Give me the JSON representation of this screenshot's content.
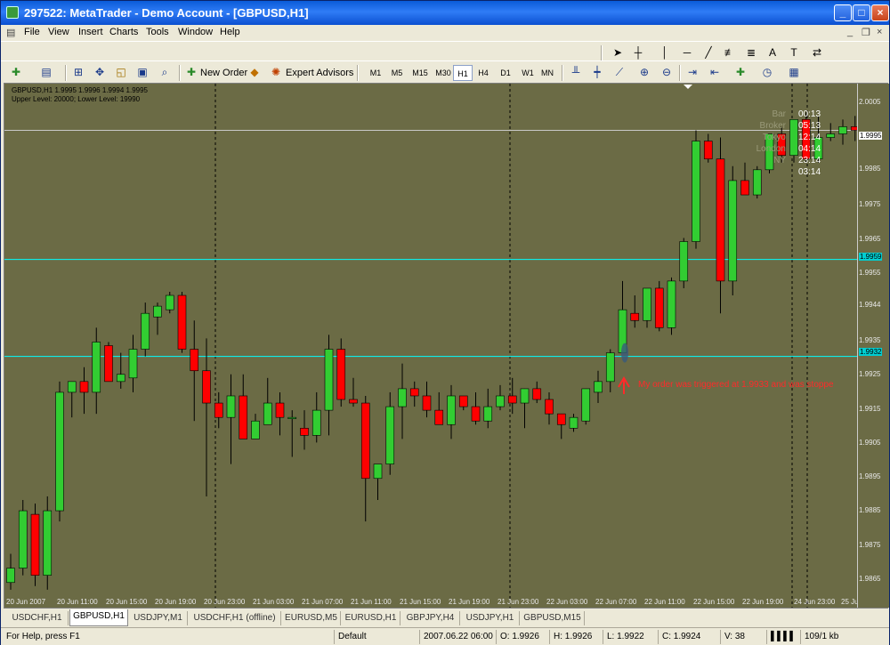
{
  "window": {
    "title": "297522: MetaTrader - Demo Account - [GBPUSD,H1]"
  },
  "menu": [
    "File",
    "View",
    "Insert",
    "Charts",
    "Tools",
    "Window",
    "Help"
  ],
  "toolbar": {
    "new_order_label": "New Order",
    "expert_advisors_label": "Expert Advisors",
    "timeframes": [
      "M1",
      "M5",
      "M15",
      "M30",
      "H1",
      "H4",
      "D1",
      "W1",
      "MN"
    ],
    "active_timeframe": "H1"
  },
  "chart": {
    "info_line1": "GBPUSD,H1  1.9995 1.9996 1.9994 1.9995",
    "info_line2": "Upper Level: 20000;  Lower Level: 19990",
    "annotation": "My order was triggered at 1.9933 and was stoppe",
    "current_price_tag": "1.9995",
    "upper_line_tag": "1.9959",
    "lower_line_tag": "1.9932",
    "y_labels": [
      "2.0005",
      "1.9995",
      "1.9985",
      "1.9975",
      "1.9965",
      "1.9955",
      "1.9944",
      "1.9935",
      "1.9925",
      "1.9915",
      "1.9905",
      "1.9895",
      "1.9885",
      "1.9875",
      "1.9865"
    ],
    "x_labels": [
      "20 Jun 2007",
      "20 Jun 11:00",
      "20 Jun 15:00",
      "20 Jun 19:00",
      "20 Jun 23:00",
      "21 Jun 03:00",
      "21 Jun 07:00",
      "21 Jun 11:00",
      "21 Jun 15:00",
      "21 Jun 19:00",
      "21 Jun 23:00",
      "22 Jun 03:00",
      "22 Jun 07:00",
      "22 Jun 11:00",
      "22 Jun 15:00",
      "22 Jun 19:00",
      "24 Jun 23:00",
      "25 Jun 03:00"
    ],
    "stats": [
      {
        "key": "Bar",
        "value": "00:13"
      },
      {
        "key": "Broker",
        "value": "05:13"
      },
      {
        "key": "Tokyo",
        "value": "12:14"
      },
      {
        "key": "London",
        "value": "04:14"
      },
      {
        "key": "NY",
        "value": "23:14"
      },
      {
        "key": "",
        "value": "03:14"
      }
    ],
    "colors": {
      "background": "#6b6b45",
      "bull": "#32cd32",
      "bear": "#ff0000",
      "level": "#00ffff",
      "annotation": "#ff2a2a"
    }
  },
  "chart_data": {
    "type": "candlestick",
    "candles": [
      [
        1.9869,
        1.9877,
        1.9867,
        1.9873
      ],
      [
        1.9873,
        1.9892,
        1.9871,
        1.9889
      ],
      [
        1.9888,
        1.9891,
        1.9868,
        1.9871
      ],
      [
        1.9871,
        1.9893,
        1.9867,
        1.9889
      ],
      [
        1.9889,
        1.9925,
        1.9886,
        1.9922
      ],
      [
        1.9922,
        1.9925,
        1.9915,
        1.9925
      ],
      [
        1.9925,
        1.9929,
        1.9916,
        1.9922
      ],
      [
        1.9922,
        1.994,
        1.9916,
        1.9936
      ],
      [
        1.9935,
        1.9936,
        1.9925,
        1.9925
      ],
      [
        1.9925,
        1.9933,
        1.9923,
        1.9927
      ],
      [
        1.9926,
        1.9938,
        1.9922,
        1.9934
      ],
      [
        1.9934,
        1.9947,
        1.9932,
        1.9944
      ],
      [
        1.9943,
        1.9947,
        1.9938,
        1.9946
      ],
      [
        1.9945,
        1.995,
        1.9944,
        1.9949
      ],
      [
        1.9949,
        1.995,
        1.9933,
        1.9934
      ],
      [
        1.9934,
        1.9942,
        1.9914,
        1.9928
      ],
      [
        1.9928,
        1.9937,
        1.9893,
        1.9919
      ],
      [
        1.9919,
        1.9922,
        1.9912,
        1.9915
      ],
      [
        1.9915,
        1.9927,
        1.9902,
        1.9921
      ],
      [
        1.9921,
        1.9927,
        1.9912,
        1.9909
      ],
      [
        1.9909,
        1.9916,
        1.9909,
        1.9914
      ],
      [
        1.9913,
        1.9926,
        1.9913,
        1.9919
      ],
      [
        1.9919,
        1.9922,
        1.991,
        1.9915
      ],
      [
        1.9915,
        1.9917,
        1.9904,
        1.9915
      ],
      [
        1.9912,
        1.9917,
        1.9906,
        1.991
      ],
      [
        1.991,
        1.9922,
        1.9908,
        1.9917
      ],
      [
        1.9917,
        1.9938,
        1.991,
        1.9934
      ],
      [
        1.9934,
        1.9937,
        1.9918,
        1.992
      ],
      [
        1.992,
        1.9926,
        1.9918,
        1.9919
      ],
      [
        1.9919,
        1.9921,
        1.9886,
        1.9898
      ],
      [
        1.9898,
        1.9899,
        1.9892,
        1.9902
      ],
      [
        1.9902,
        1.9922,
        1.9899,
        1.9918
      ],
      [
        1.9918,
        1.993,
        1.9909,
        1.9923
      ],
      [
        1.9923,
        1.9925,
        1.9918,
        1.9921
      ],
      [
        1.9921,
        1.9925,
        1.9915,
        1.9917
      ],
      [
        1.9917,
        1.9922,
        1.9913,
        1.9913
      ],
      [
        1.9913,
        1.9924,
        1.9909,
        1.9921
      ],
      [
        1.9921,
        1.9921,
        1.9917,
        1.9918
      ],
      [
        1.9918,
        1.9922,
        1.9913,
        1.9914
      ],
      [
        1.9914,
        1.9923,
        1.9912,
        1.9918
      ],
      [
        1.9918,
        1.9924,
        1.9917,
        1.9921
      ],
      [
        1.9921,
        1.9926,
        1.9916,
        1.9919
      ],
      [
        1.9919,
        1.9923,
        1.9912,
        1.9923
      ],
      [
        1.9923,
        1.9925,
        1.9919,
        1.992
      ],
      [
        1.992,
        1.9922,
        1.9913,
        1.9916
      ],
      [
        1.9916,
        1.9916,
        1.9909,
        1.9913
      ],
      [
        1.9912,
        1.9916,
        1.9911,
        1.9915
      ],
      [
        1.9914,
        1.9923,
        1.9913,
        1.9923
      ],
      [
        1.9922,
        1.9928,
        1.9919,
        1.9925
      ],
      [
        1.9925,
        1.9934,
        1.9922,
        1.9933
      ],
      [
        1.9933,
        1.9953,
        1.9933,
        1.9945
      ],
      [
        1.9944,
        1.9949,
        1.994,
        1.9942
      ],
      [
        1.9942,
        1.9951,
        1.994,
        1.9951
      ],
      [
        1.9951,
        1.9953,
        1.9939,
        1.994
      ],
      [
        1.994,
        1.9954,
        1.9938,
        1.9953
      ],
      [
        1.9953,
        1.9965,
        1.9951,
        1.9964
      ],
      [
        1.9964,
        1.9995,
        1.9962,
        1.9992
      ],
      [
        1.9992,
        1.9994,
        1.9986,
        1.9987
      ],
      [
        1.9987,
        1.9993,
        1.9944,
        1.9953
      ],
      [
        1.9953,
        1.9985,
        1.9949,
        1.9981
      ],
      [
        1.9981,
        1.9986,
        1.9977,
        1.9977
      ],
      [
        1.9977,
        1.9985,
        1.9976,
        1.9984
      ],
      [
        1.9984,
        1.9994,
        1.9983,
        1.9994
      ],
      [
        1.9994,
        1.9996,
        1.9986,
        1.9988
      ],
      [
        1.9988,
        1.9996,
        1.9986,
        1.9998
      ],
      [
        1.9998,
        2.0,
        1.9986,
        1.9987
      ],
      [
        1.9987,
        1.9999,
        1.9986,
        1.9993
      ],
      [
        1.9993,
        1.9997,
        1.9992,
        1.9994
      ],
      [
        1.9994,
        1.9998,
        1.9991,
        1.9996
      ],
      [
        1.9996,
        1.9999,
        1.9992,
        1.9995
      ]
    ],
    "horizontal_lines": [
      1.9959,
      1.9932
    ],
    "current_price": 1.9995
  },
  "tabs": [
    "USDCHF,H1",
    "GBPUSD,H1",
    "USDJPY,M1",
    "USDCHF,H1 (offline)",
    "EURUSD,M5",
    "EURUSD,H1",
    "GBPJPY,H4",
    "USDJPY,H1",
    "GBPUSD,M15"
  ],
  "active_tab": "GBPUSD,H1",
  "status": {
    "help": "For Help, press F1",
    "profile": "Default",
    "datetime": "2007.06.22 06:00",
    "open": "O: 1.9926",
    "high": "H: 1.9926",
    "low": "L: 1.9922",
    "close": "C: 1.9924",
    "volume": "V: 38",
    "traffic": "109/1 kb"
  }
}
